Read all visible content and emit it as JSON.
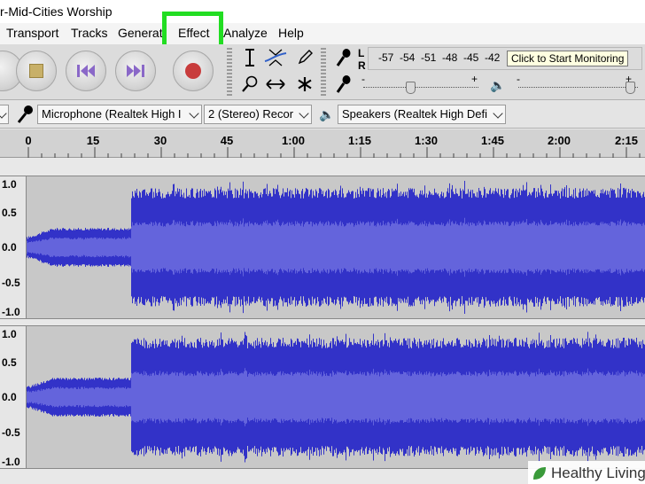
{
  "window": {
    "title": "r-Mid-Cities Worship"
  },
  "menu": {
    "transport": "Transport",
    "tracks": "Tracks",
    "generate": "Generate",
    "effect": "Effect",
    "analyze": "Analyze",
    "help": "Help"
  },
  "meter": {
    "channels": [
      "L",
      "R"
    ],
    "scale": [
      "-57",
      "-54",
      "-51",
      "-48",
      "-45",
      "-42"
    ],
    "tooltip": "Click to Start Monitoring",
    "playback_slider_signs": [
      "-",
      "+"
    ]
  },
  "devices": {
    "input": "Microphone (Realtek High I",
    "channels": "2 (Stereo) Recor",
    "output": "Speakers (Realtek High Defi"
  },
  "timeline": {
    "labels": [
      "0",
      "15",
      "30",
      "45",
      "1:00",
      "1:15",
      "1:30",
      "1:45",
      "2:00",
      "2:15"
    ]
  },
  "tracks": {
    "scale_labels": [
      "1.0",
      "0.5",
      "0.0",
      "-0.5",
      "-1.0"
    ]
  },
  "colors": {
    "waveform": "#3232c8",
    "waveform_rms": "#6464dc",
    "highlight": "#22dd22"
  },
  "watermark": {
    "text": "Healthy Living"
  }
}
